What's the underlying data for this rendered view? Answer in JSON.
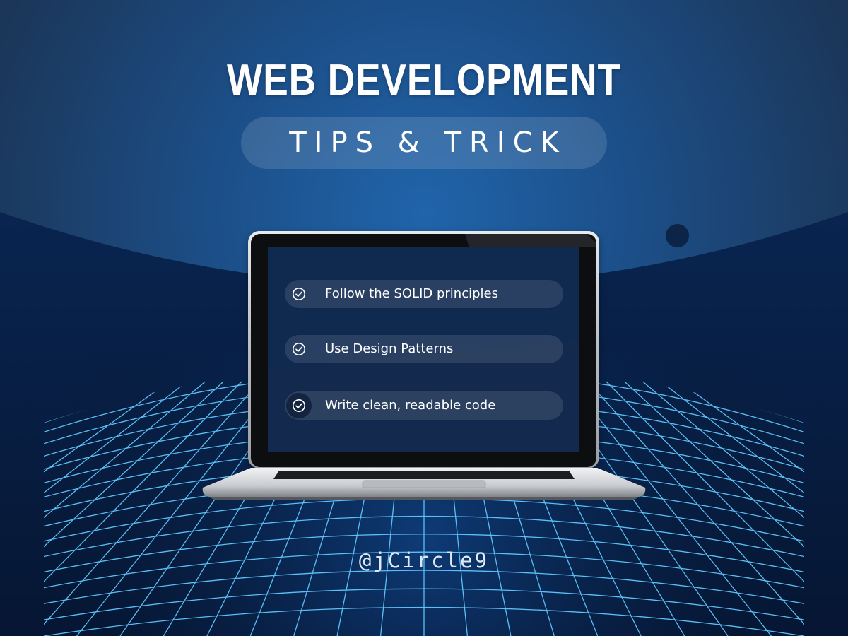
{
  "headline": "WEB DEVELOPMENT",
  "subtitle": "TIPS & TRICK",
  "tips": [
    {
      "label": "Follow the SOLID principles",
      "icon": "check-circle-icon"
    },
    {
      "label": "Use Design Patterns",
      "icon": "check-circle-icon"
    },
    {
      "label": "Write clean, readable code",
      "icon": "check-circle-icon"
    }
  ],
  "handle": "@jCircle9",
  "colors": {
    "background_top": "#1f3f66",
    "background_center": "#1f5a9e",
    "grid_line": "#5fc8ff",
    "screen": "#13294d",
    "text": "#ffffff"
  }
}
